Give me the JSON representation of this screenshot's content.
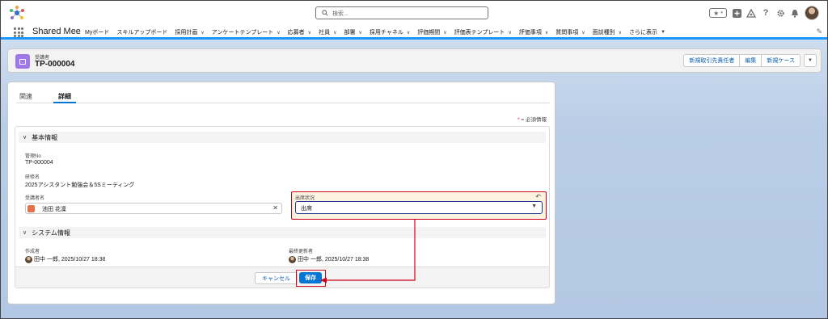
{
  "header": {
    "search_placeholder": "検索...",
    "icons": [
      "favorites-star-icon",
      "favorites-dropdown-icon",
      "add-icon",
      "trailhead-icon",
      "help-icon",
      "setup-gear-icon",
      "notifications-bell-icon",
      "user-avatar"
    ]
  },
  "nav": {
    "app_name": "Shared Mee",
    "items": [
      {
        "label": "Myボード",
        "has_menu": false
      },
      {
        "label": "スキルアップボード",
        "has_menu": false
      },
      {
        "label": "採用計画",
        "has_menu": true
      },
      {
        "label": "アンケートテンプレート",
        "has_menu": true
      },
      {
        "label": "応募者",
        "has_menu": true
      },
      {
        "label": "社員",
        "has_menu": true
      },
      {
        "label": "部署",
        "has_menu": true
      },
      {
        "label": "採用チャネル",
        "has_menu": true
      },
      {
        "label": "評価期間",
        "has_menu": true
      },
      {
        "label": "評価表テンプレート",
        "has_menu": true
      },
      {
        "label": "評価事項",
        "has_menu": true
      },
      {
        "label": "質問事項",
        "has_menu": true
      },
      {
        "label": "面談種別",
        "has_menu": true
      },
      {
        "label": "さらに表示",
        "has_menu": true
      }
    ]
  },
  "record": {
    "type_label": "受講者",
    "title": "TP-000004",
    "actions": [
      "新規取引先責任者",
      "編集",
      "新規ケース"
    ]
  },
  "tabs": [
    {
      "label": "関連",
      "active": false
    },
    {
      "label": "詳細",
      "active": true
    }
  ],
  "required_note": {
    "star": "*",
    "text": " = 必須情報"
  },
  "sections": {
    "basic": {
      "title": "基本情報",
      "fields": {
        "management_no": {
          "label": "管理No",
          "value": "TP-000004"
        },
        "training_name": {
          "label": "研修名",
          "value": "2025アシスタント勉強会＆5Sミーティング"
        },
        "attendee_name": {
          "label": "受講者名",
          "value": "池田 花凜"
        },
        "attendance_status": {
          "label": "出席状況",
          "value": "出席"
        }
      }
    },
    "system": {
      "title": "システム情報",
      "fields": {
        "created_by": {
          "label": "作成者",
          "value": "田中 一郎, 2025/10/27 18:38"
        },
        "modified_by": {
          "label": "最終更新者",
          "value": "田中 一郎, 2025/10/27 18:38"
        }
      }
    }
  },
  "footer": {
    "cancel_label": "キャンセル",
    "save_label": "保存"
  },
  "colors": {
    "brand_blue": "#0176d3",
    "highlight_red": "#d0021b",
    "record_icon": "#a077e6",
    "edited_field_bg": "#fbf3e0"
  }
}
